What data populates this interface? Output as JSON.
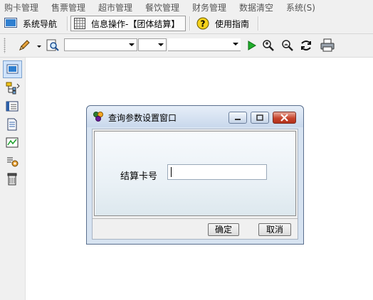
{
  "menubar": {
    "items": [
      "购卡管理",
      "售票管理",
      "超市管理",
      "餐饮管理",
      "财务管理",
      "数据清空",
      "系统(S)"
    ]
  },
  "navbar": {
    "system_nav": "系统导航",
    "info_ops": "信息操作-【团体结算】",
    "help": "使用指南"
  },
  "toolbar": {
    "combo1_value": "",
    "combo2_value": "",
    "combo3_value": ""
  },
  "dialog": {
    "title": "查询参数设置窗口",
    "field_label": "结算卡号",
    "field_value": "",
    "ok_label": "确定",
    "cancel_label": "取消"
  },
  "colors": {
    "dialog_frame": "#d7e3f1",
    "titlebar_top": "#e6eef8",
    "close_red": "#c7452d",
    "active_strip": "#cfe3fb"
  },
  "icons": {
    "toolbar": [
      "pencil-icon",
      "find-icon",
      "play-icon",
      "search-person-icon",
      "search-user-icon",
      "refresh-icon",
      "print-icon"
    ],
    "strip": [
      "window-icon",
      "tree-icon",
      "list-icon",
      "document-icon",
      "chart-icon",
      "settings-icon",
      "trash-icon"
    ]
  }
}
